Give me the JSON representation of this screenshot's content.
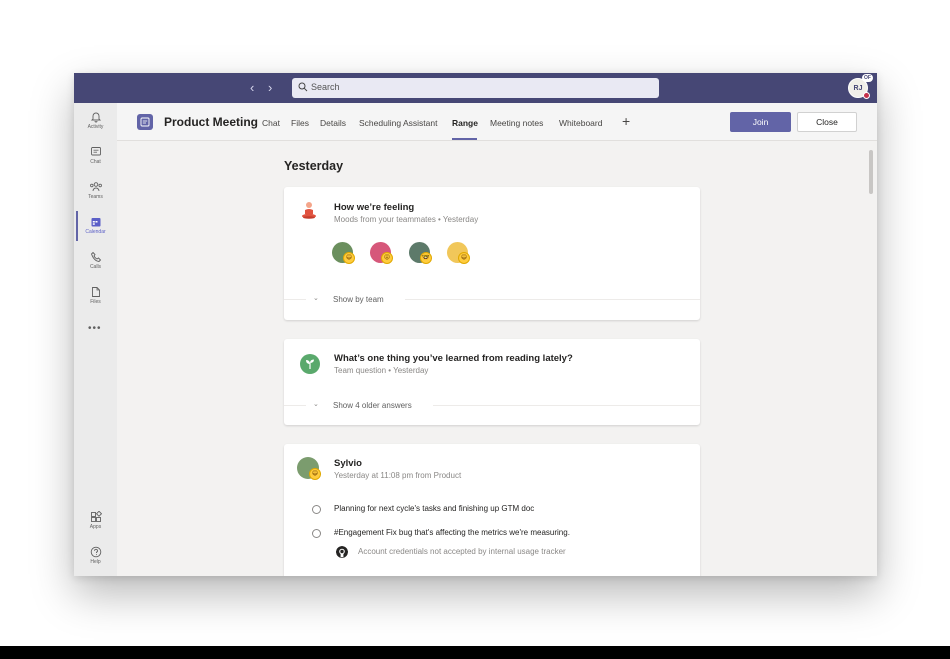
{
  "titlebar": {
    "search_placeholder": "Search",
    "user_initials": "RJ",
    "user_badge": "OF"
  },
  "rail": {
    "items": [
      {
        "label": "Activity",
        "icon": "bell-icon"
      },
      {
        "label": "Chat",
        "icon": "chat-icon"
      },
      {
        "label": "Teams",
        "icon": "teams-icon"
      },
      {
        "label": "Calendar",
        "icon": "calendar-icon",
        "active": true
      },
      {
        "label": "Calls",
        "icon": "phone-icon"
      },
      {
        "label": "Files",
        "icon": "file-icon"
      }
    ],
    "more": "•••",
    "bottom": [
      {
        "label": "Apps",
        "icon": "apps-icon"
      },
      {
        "label": "Help",
        "icon": "help-icon"
      }
    ]
  },
  "header": {
    "title": "Product Meeting",
    "tabs": [
      "Chat",
      "Files",
      "Details",
      "Scheduling Assistant",
      "Range",
      "Meeting notes",
      "Whiteboard"
    ],
    "active_tab": "Range",
    "plus": "+",
    "join_label": "Join",
    "close_label": "Close"
  },
  "feed": {
    "heading": "Yesterday",
    "mood_card": {
      "title": "How we’re feeling",
      "subtitle": "Moods from your teammates • Yesterday",
      "footer": "Show by team",
      "moods": [
        "😄",
        "😝",
        "🤓",
        "😄"
      ]
    },
    "question_card": {
      "title": "What’s one thing you’ve learned from reading lately?",
      "subtitle": "Team question • Yesterday",
      "footer": "Show 4 older answers"
    },
    "post_card": {
      "author": "Sylvio",
      "meta": "Yesterday at 11:08 pm from Product",
      "tasks": [
        "Planning for next cycle's tasks and finishing up GTM doc",
        "#Engagement Fix bug that's affecting the metrics we're measuring."
      ],
      "linked_issue": "Account credentials not accepted by internal usage tracker"
    }
  },
  "colors": {
    "titlebar": "#464775",
    "accent": "#6264a7",
    "rail": "#ebebeb",
    "background": "#f3f2f1"
  }
}
